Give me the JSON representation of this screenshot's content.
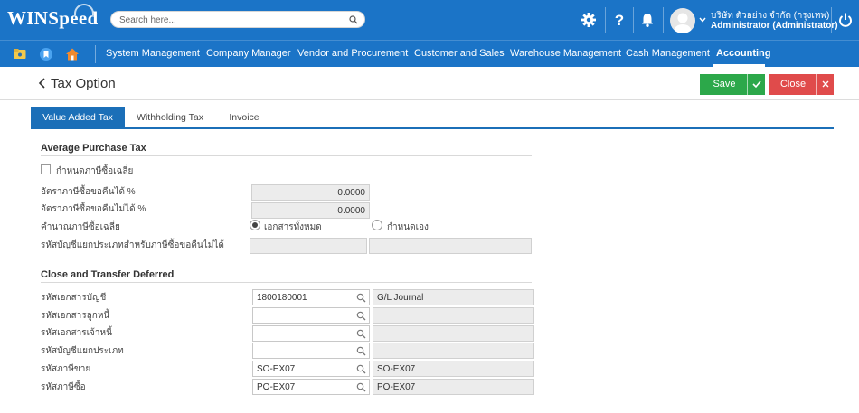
{
  "app": {
    "logo": "WINSpeed",
    "search_placeholder": "Search here...",
    "user_company": "บริษัท ตัวอย่าง จำกัด (กรุงเทพ)",
    "user_name": "Administrator (Administrator)"
  },
  "menu": {
    "items": [
      "System Management",
      "Company Manager",
      "Vendor and Procurement",
      "Customer and Sales",
      "Warehouse Management",
      "Cash Management",
      "Accounting"
    ],
    "active": "Accounting"
  },
  "header": {
    "title": "Tax Option",
    "save_label": "Save",
    "close_label": "Close"
  },
  "tabs": [
    "Value Added Tax",
    "Withholding Tax",
    "Invoice"
  ],
  "average_purchase_tax": {
    "title": "Average Purchase Tax",
    "checkbox_label": "กำหนดภาษีซื้อเฉลี่ย",
    "refundable_label": "อัตราภาษีซื้อขอคืนได้ %",
    "refundable_value": "0.0000",
    "nonrefundable_label": "อัตราภาษีซื้อขอคืนไม่ได้ %",
    "nonrefundable_value": "0.0000",
    "calc_label": "คำนวณภาษีซื้อเฉลี่ย",
    "radio_all": "เอกสารทั้งหมด",
    "radio_manual": "กำหนดเอง",
    "account_label": "รหัสบัญชีแยกประเภทสำหรับภาษีซื้อขอคืนไม่ได้"
  },
  "close_transfer": {
    "title": "Close and Transfer Deferred",
    "rows": [
      {
        "label": "รหัสเอกสารบัญชี",
        "code": "1800180001",
        "desc": "G/L Journal"
      },
      {
        "label": "รหัสเอกสารลูกหนี้",
        "code": "",
        "desc": ""
      },
      {
        "label": "รหัสเอกสารเจ้าหนี้",
        "code": "",
        "desc": ""
      },
      {
        "label": "รหัสบัญชีแยกประเภท",
        "code": "",
        "desc": ""
      },
      {
        "label": "รหัสภาษีขาย",
        "code": "SO-EX07",
        "desc": "SO-EX07"
      },
      {
        "label": "รหัสภาษีซื้อ",
        "code": "PO-EX07",
        "desc": "PO-EX07"
      }
    ]
  },
  "colors": {
    "brand": "#1b74c7",
    "save": "#2ca84a",
    "close": "#e04b4b",
    "tab_active": "#1b6fb8"
  }
}
